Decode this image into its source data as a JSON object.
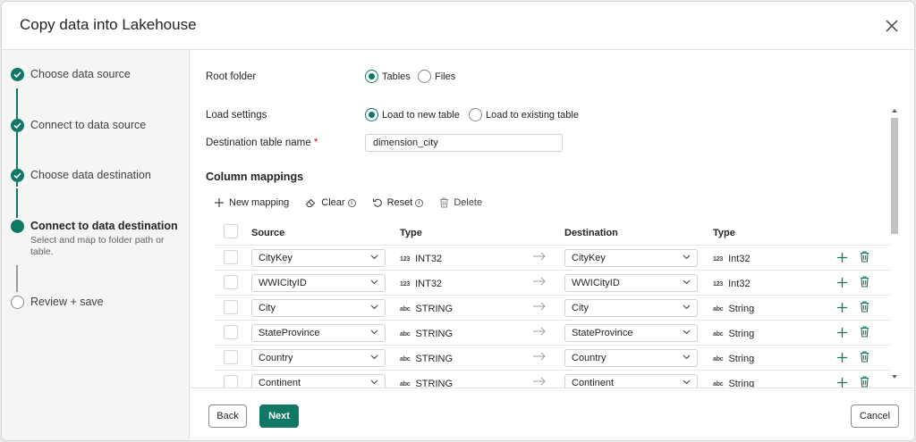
{
  "dialog": {
    "title": "Copy data into Lakehouse"
  },
  "steps": [
    {
      "label": "Choose data source",
      "state": "done"
    },
    {
      "label": "Connect to data source",
      "state": "done"
    },
    {
      "label": "Choose data destination",
      "state": "done"
    },
    {
      "label": "Connect to data destination",
      "state": "current",
      "description": "Select and map to folder path or table."
    },
    {
      "label": "Review + save",
      "state": "pending"
    }
  ],
  "root_folder": {
    "label": "Root folder",
    "options": [
      {
        "label": "Tables",
        "selected": true
      },
      {
        "label": "Files",
        "selected": false
      }
    ]
  },
  "load_settings": {
    "label": "Load settings",
    "options": [
      {
        "label": "Load to new table",
        "selected": true
      },
      {
        "label": "Load to existing table",
        "selected": false
      }
    ]
  },
  "destination_table": {
    "label": "Destination table name",
    "required_mark": "*",
    "value": "dimension_city"
  },
  "column_mappings": {
    "title": "Column mappings",
    "toolbar": {
      "new_mapping": "New mapping",
      "clear": "Clear",
      "reset": "Reset",
      "delete": "Delete"
    },
    "headers": {
      "source": "Source",
      "source_type": "Type",
      "destination": "Destination",
      "destination_type": "Type"
    },
    "rows": [
      {
        "source": "CityKey",
        "source_type_icon": "123",
        "source_type": "INT32",
        "destination": "CityKey",
        "dest_type_icon": "123",
        "dest_type": "Int32"
      },
      {
        "source": "WWICityID",
        "source_type_icon": "123",
        "source_type": "INT32",
        "destination": "WWICityID",
        "dest_type_icon": "123",
        "dest_type": "Int32"
      },
      {
        "source": "City",
        "source_type_icon": "abc",
        "source_type": "STRING",
        "destination": "City",
        "dest_type_icon": "abc",
        "dest_type": "String"
      },
      {
        "source": "StateProvince",
        "source_type_icon": "abc",
        "source_type": "STRING",
        "destination": "StateProvince",
        "dest_type_icon": "abc",
        "dest_type": "String"
      },
      {
        "source": "Country",
        "source_type_icon": "abc",
        "source_type": "STRING",
        "destination": "Country",
        "dest_type_icon": "abc",
        "dest_type": "String"
      },
      {
        "source": "Continent",
        "source_type_icon": "abc",
        "source_type": "STRING",
        "destination": "Continent",
        "dest_type_icon": "abc",
        "dest_type": "String"
      }
    ]
  },
  "footer": {
    "back": "Back",
    "next": "Next",
    "cancel": "Cancel"
  },
  "colors": {
    "accent": "#117865",
    "danger": "#c50f1f"
  }
}
